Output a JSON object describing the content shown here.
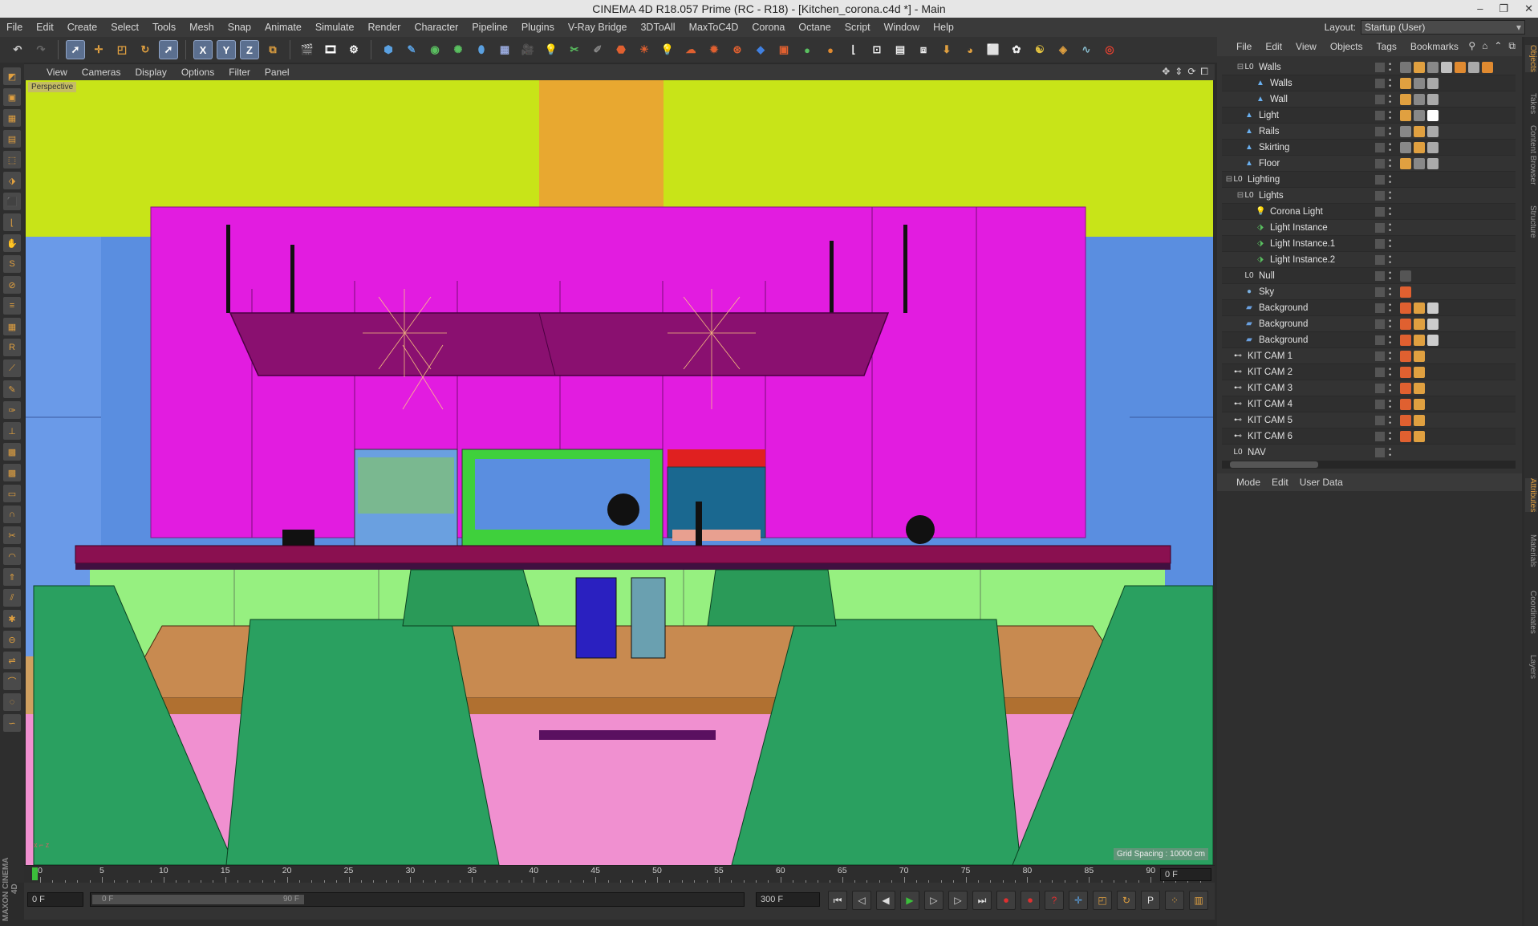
{
  "window": {
    "title": "CINEMA 4D R18.057 Prime (RC - R18) - [Kitchen_corona.c4d *] - Main",
    "controls": [
      "–",
      "❐",
      "✕"
    ]
  },
  "menubar": {
    "items": [
      "File",
      "Edit",
      "Create",
      "Select",
      "Tools",
      "Mesh",
      "Snap",
      "Animate",
      "Simulate",
      "Render",
      "Character",
      "Pipeline",
      "Plugins",
      "V-Ray Bridge",
      "3DToAll",
      "MaxToC4D",
      "Corona",
      "Octane",
      "Script",
      "Window",
      "Help"
    ],
    "layout_label": "Layout:",
    "layout_value": "Startup (User)"
  },
  "toolbar": {
    "axis_x": "X",
    "axis_y": "Y",
    "axis_z": "Z"
  },
  "viewport": {
    "menu": [
      "View",
      "Cameras",
      "Display",
      "Options",
      "Filter",
      "Panel"
    ],
    "camera_label": "Perspective",
    "grid_spacing": "Grid Spacing : 10000 cm"
  },
  "timeline": {
    "ticks": [
      "0",
      "5",
      "10",
      "15",
      "20",
      "25",
      "30",
      "35",
      "40",
      "45",
      "50",
      "55",
      "60",
      "65",
      "70",
      "75",
      "80",
      "85",
      "90"
    ],
    "current_frame": "0 F"
  },
  "transport": {
    "start_frame": "0 F",
    "range_start": "0 F",
    "range_end": "90 F",
    "end_frame": "300 F"
  },
  "object_manager": {
    "menu": [
      "File",
      "Edit",
      "View",
      "Objects",
      "Tags",
      "Bookmarks"
    ],
    "objects": [
      {
        "name": "Walls",
        "indent": 1,
        "icon": "null-icon",
        "twist": "⊟"
      },
      {
        "name": "Walls",
        "indent": 2,
        "icon": "polygon-object-icon",
        "twist": ""
      },
      {
        "name": "Wall",
        "indent": 2,
        "icon": "polygon-object-icon",
        "twist": ""
      },
      {
        "name": "Light",
        "indent": 1,
        "icon": "polygon-object-icon",
        "twist": ""
      },
      {
        "name": "Rails",
        "indent": 1,
        "icon": "polygon-object-icon",
        "twist": ""
      },
      {
        "name": "Skirting",
        "indent": 1,
        "icon": "polygon-object-icon",
        "twist": ""
      },
      {
        "name": "Floor",
        "indent": 1,
        "icon": "polygon-object-icon",
        "twist": ""
      },
      {
        "name": "Lighting",
        "indent": 0,
        "icon": "null-icon",
        "twist": "⊟"
      },
      {
        "name": "Lights",
        "indent": 1,
        "icon": "null-icon",
        "twist": "⊟"
      },
      {
        "name": "Corona Light",
        "indent": 2,
        "icon": "corona-light-icon",
        "twist": ""
      },
      {
        "name": "Light Instance",
        "indent": 2,
        "icon": "instance-icon",
        "twist": ""
      },
      {
        "name": "Light Instance.1",
        "indent": 2,
        "icon": "instance-icon",
        "twist": ""
      },
      {
        "name": "Light Instance.2",
        "indent": 2,
        "icon": "instance-icon",
        "twist": ""
      },
      {
        "name": "Null",
        "indent": 1,
        "icon": "null-icon",
        "twist": ""
      },
      {
        "name": "Sky",
        "indent": 1,
        "icon": "sky-icon",
        "twist": ""
      },
      {
        "name": "Background",
        "indent": 1,
        "icon": "background-icon",
        "twist": ""
      },
      {
        "name": "Background",
        "indent": 1,
        "icon": "background-icon",
        "twist": ""
      },
      {
        "name": "Background",
        "indent": 1,
        "icon": "background-icon",
        "twist": ""
      },
      {
        "name": "KIT CAM 1",
        "indent": 0,
        "icon": "camera-icon",
        "twist": ""
      },
      {
        "name": "KIT CAM 2",
        "indent": 0,
        "icon": "camera-icon",
        "twist": ""
      },
      {
        "name": "KIT  CAM 3",
        "indent": 0,
        "icon": "camera-icon",
        "twist": ""
      },
      {
        "name": "KIT  CAM 4",
        "indent": 0,
        "icon": "camera-icon",
        "twist": ""
      },
      {
        "name": "KIT  CAM 5",
        "indent": 0,
        "icon": "camera-icon",
        "twist": ""
      },
      {
        "name": "KIT  CAM 6",
        "indent": 0,
        "icon": "camera-icon",
        "twist": ""
      },
      {
        "name": "NAV",
        "indent": 0,
        "icon": "null-icon",
        "twist": ""
      }
    ]
  },
  "attribute_manager": {
    "menu": [
      "Mode",
      "Edit",
      "User Data"
    ]
  },
  "side_tabs": [
    "Objects",
    "Takes",
    "Content Browser",
    "Structure",
    "Attributes",
    "Materials",
    "Coordinates",
    "Layers"
  ],
  "logo": "MAXON CINEMA 4D",
  "colors": {
    "accent": "#e0a040",
    "selected_tool": "#5b6f8f",
    "playhead": "#3bbf3b"
  }
}
